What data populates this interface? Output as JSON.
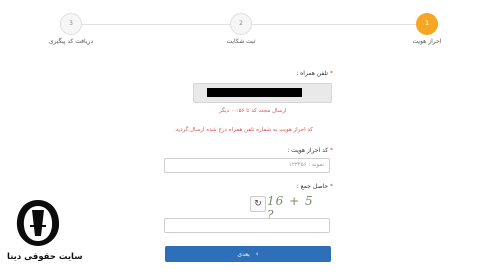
{
  "stepper": {
    "steps": [
      {
        "number": "1",
        "label": "احراز هویت",
        "active": true
      },
      {
        "number": "2",
        "label": "ثبت شکایت",
        "active": false
      },
      {
        "number": "3",
        "label": "دریافت کد پیگیری",
        "active": false
      }
    ]
  },
  "form": {
    "phone_label": "تلفن همراه :",
    "resend_text": "ارسال مجدد کد تا ۰۰:۵۶ دیگر",
    "info_text": "کد احراز هویت به شماره تلفن همراه درج شده ارسال گردید.",
    "code_label": "کد احراز هویت :",
    "code_placeholder": "نمونه : ۱۲۳۴۵۶",
    "captcha_label": "حاصل جمع :",
    "captcha_text": "16 + 5 ?",
    "submit_label": "بعدی"
  },
  "brand": {
    "name": "سایت حقوقی دینا"
  }
}
